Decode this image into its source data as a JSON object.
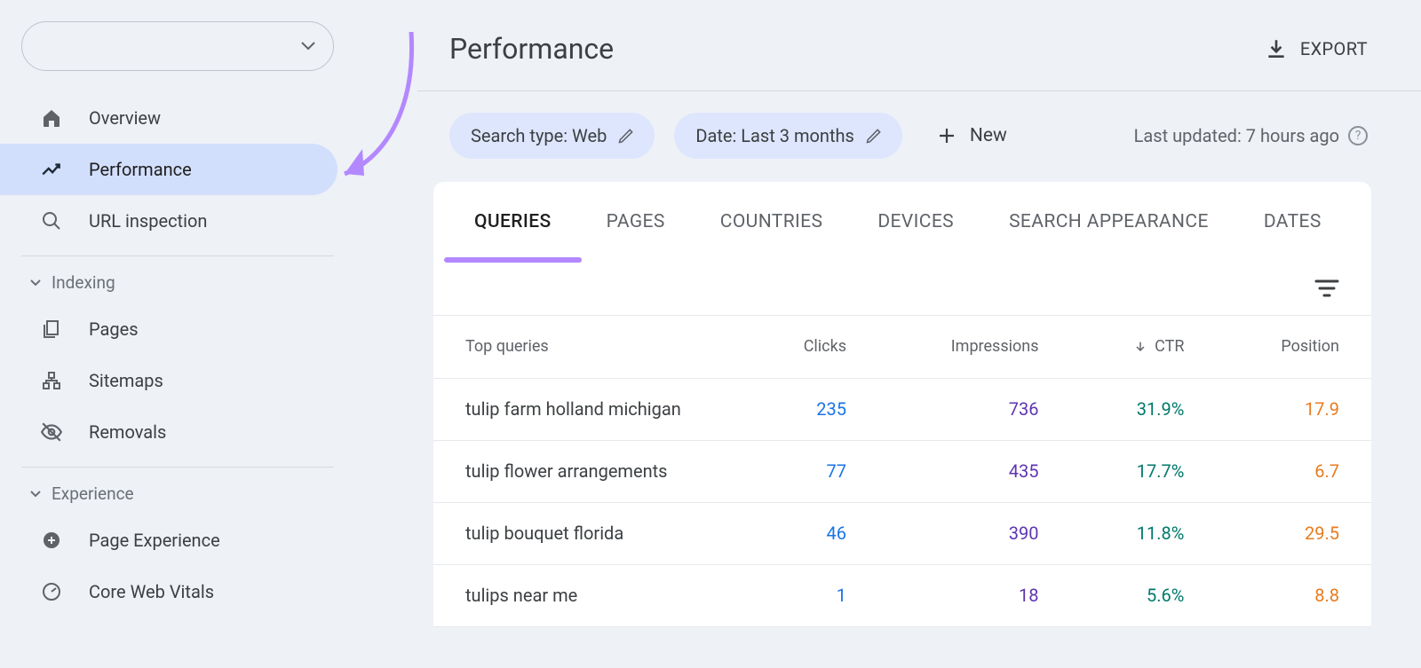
{
  "sidebar": {
    "items": [
      {
        "label": "Overview"
      },
      {
        "label": "Performance"
      },
      {
        "label": "URL inspection"
      }
    ],
    "sections": {
      "indexing": {
        "title": "Indexing",
        "items": [
          {
            "label": "Pages"
          },
          {
            "label": "Sitemaps"
          },
          {
            "label": "Removals"
          }
        ]
      },
      "experience": {
        "title": "Experience",
        "items": [
          {
            "label": "Page Experience"
          },
          {
            "label": "Core Web Vitals"
          }
        ]
      }
    }
  },
  "header": {
    "title": "Performance",
    "export_label": "EXPORT"
  },
  "controls": {
    "search_type_chip": "Search type: Web",
    "date_chip": "Date: Last 3 months",
    "add_new_label": "New",
    "last_updated": "Last updated: 7 hours ago"
  },
  "tabs": [
    "QUERIES",
    "PAGES",
    "COUNTRIES",
    "DEVICES",
    "SEARCH APPEARANCE",
    "DATES"
  ],
  "table": {
    "columns": {
      "query": "Top queries",
      "clicks": "Clicks",
      "impressions": "Impressions",
      "ctr": "CTR",
      "position": "Position"
    },
    "rows": [
      {
        "query": "tulip farm holland michigan",
        "clicks": "235",
        "impressions": "736",
        "ctr": "31.9%",
        "position": "17.9"
      },
      {
        "query": "tulip flower arrangements",
        "clicks": "77",
        "impressions": "435",
        "ctr": "17.7%",
        "position": "6.7"
      },
      {
        "query": "tulip bouquet florida",
        "clicks": "46",
        "impressions": "390",
        "ctr": "11.8%",
        "position": "29.5"
      },
      {
        "query": "tulips near me",
        "clicks": "1",
        "impressions": "18",
        "ctr": "5.6%",
        "position": "8.8"
      }
    ]
  }
}
